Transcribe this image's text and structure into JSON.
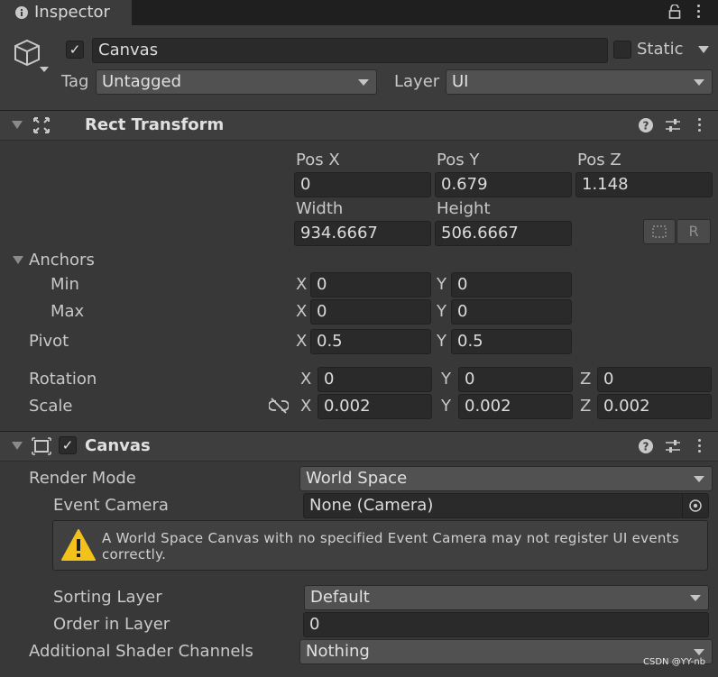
{
  "tab": {
    "title": "Inspector"
  },
  "object": {
    "name": "Canvas",
    "static_label": "Static",
    "tag_label": "Tag",
    "tag_value": "Untagged",
    "layer_label": "Layer",
    "layer_value": "UI"
  },
  "rect_transform": {
    "title": "Rect Transform",
    "pos_x_label": "Pos X",
    "pos_y_label": "Pos Y",
    "pos_z_label": "Pos Z",
    "pos_x": "0",
    "pos_y": "0.679",
    "pos_z": "1.148",
    "width_label": "Width",
    "height_label": "Height",
    "width": "934.6667",
    "height": "506.6667",
    "raw_button": "R",
    "anchors_label": "Anchors",
    "min_label": "Min",
    "max_label": "Max",
    "min_x": "0",
    "min_y": "0",
    "max_x": "0",
    "max_y": "0",
    "pivot_label": "Pivot",
    "pivot_x": "0.5",
    "pivot_y": "0.5",
    "rotation_label": "Rotation",
    "rot_x": "0",
    "rot_y": "0",
    "rot_z": "0",
    "scale_label": "Scale",
    "scale_x": "0.002",
    "scale_y": "0.002",
    "scale_z": "0.002",
    "x": "X",
    "y": "Y",
    "z": "Z"
  },
  "canvas": {
    "title": "Canvas",
    "render_mode_label": "Render Mode",
    "render_mode_value": "World Space",
    "event_camera_label": "Event Camera",
    "event_camera_value": "None (Camera)",
    "warning_text": "A World Space Canvas with no specified Event Camera may not register UI events correctly.",
    "sorting_layer_label": "Sorting Layer",
    "sorting_layer_value": "Default",
    "order_in_layer_label": "Order in Layer",
    "order_in_layer_value": "0",
    "shader_channels_label": "Additional Shader Channels",
    "shader_channels_value": "Nothing"
  },
  "watermark": "CSDN @YY-nb"
}
